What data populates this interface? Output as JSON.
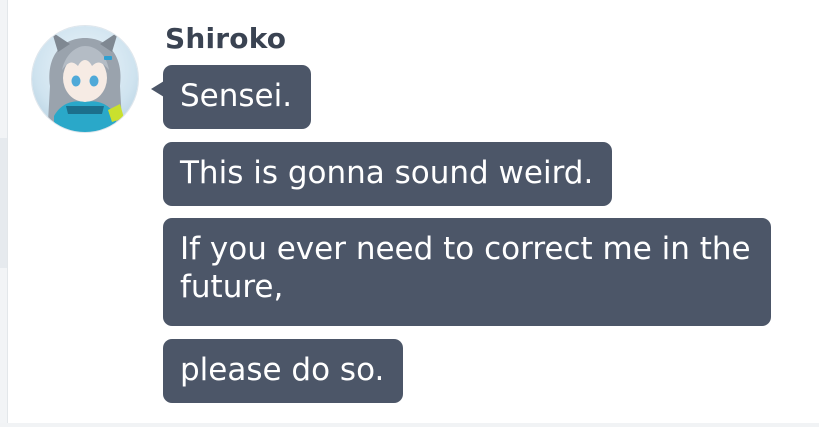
{
  "sender": {
    "name": "Shiroko",
    "avatar_icon": "student-avatar-icon"
  },
  "messages": [
    {
      "text": "Sensei."
    },
    {
      "text": "This is gonna sound weird."
    },
    {
      "text": "If you ever need to correct me in the future,"
    },
    {
      "text": "please do so."
    }
  ],
  "colors": {
    "bubble": "#4c5668",
    "bubble_text": "#ffffff",
    "name_text": "#3a4352",
    "background": "#ffffff"
  }
}
